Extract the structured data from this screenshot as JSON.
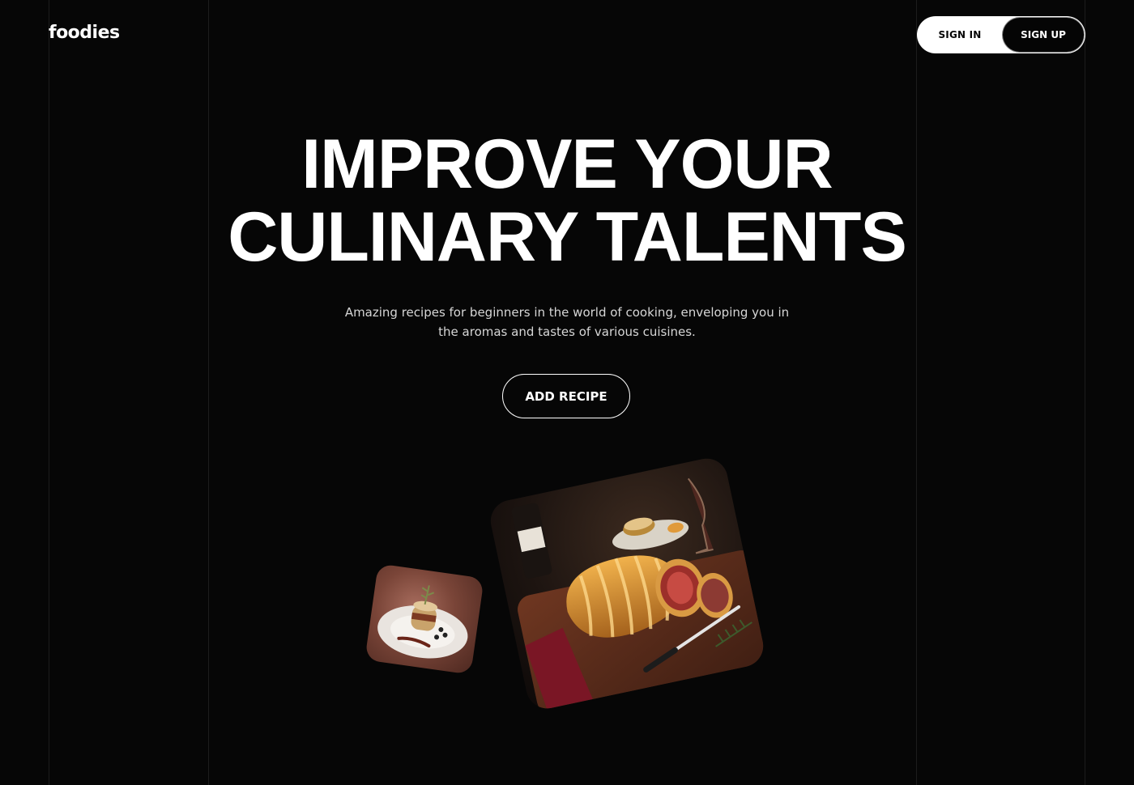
{
  "brand": {
    "logo": "foodies"
  },
  "header": {
    "sign_in_label": "SIGN IN",
    "sign_up_label": "SIGN UP"
  },
  "hero": {
    "title_line1": "IMPROVE YOUR",
    "title_line2": "CULINARY TALENTS",
    "subtitle": "Amazing recipes for beginners in the world of cooking, enveloping you in the aromas and tastes of various cuisines.",
    "cta_label": "ADD RECIPE"
  },
  "colors": {
    "background": "#060606",
    "text": "#ffffff",
    "muted_text": "#d6d6d6"
  }
}
